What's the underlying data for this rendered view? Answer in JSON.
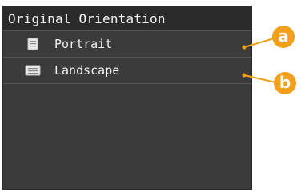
{
  "screen": {
    "title": "Original Orientation",
    "items": [
      {
        "label": "Portrait",
        "icon": "portrait-document-icon"
      },
      {
        "label": "Landscape",
        "icon": "landscape-document-icon"
      }
    ]
  },
  "callouts": [
    {
      "label": "a",
      "target": "Portrait"
    },
    {
      "label": "b",
      "target": "Landscape"
    }
  ],
  "colors": {
    "screen_bg": "#3b3b3b",
    "title_bg": "#2b2b2b",
    "text": "#f2f2f2",
    "callout": "#f2a01c"
  }
}
